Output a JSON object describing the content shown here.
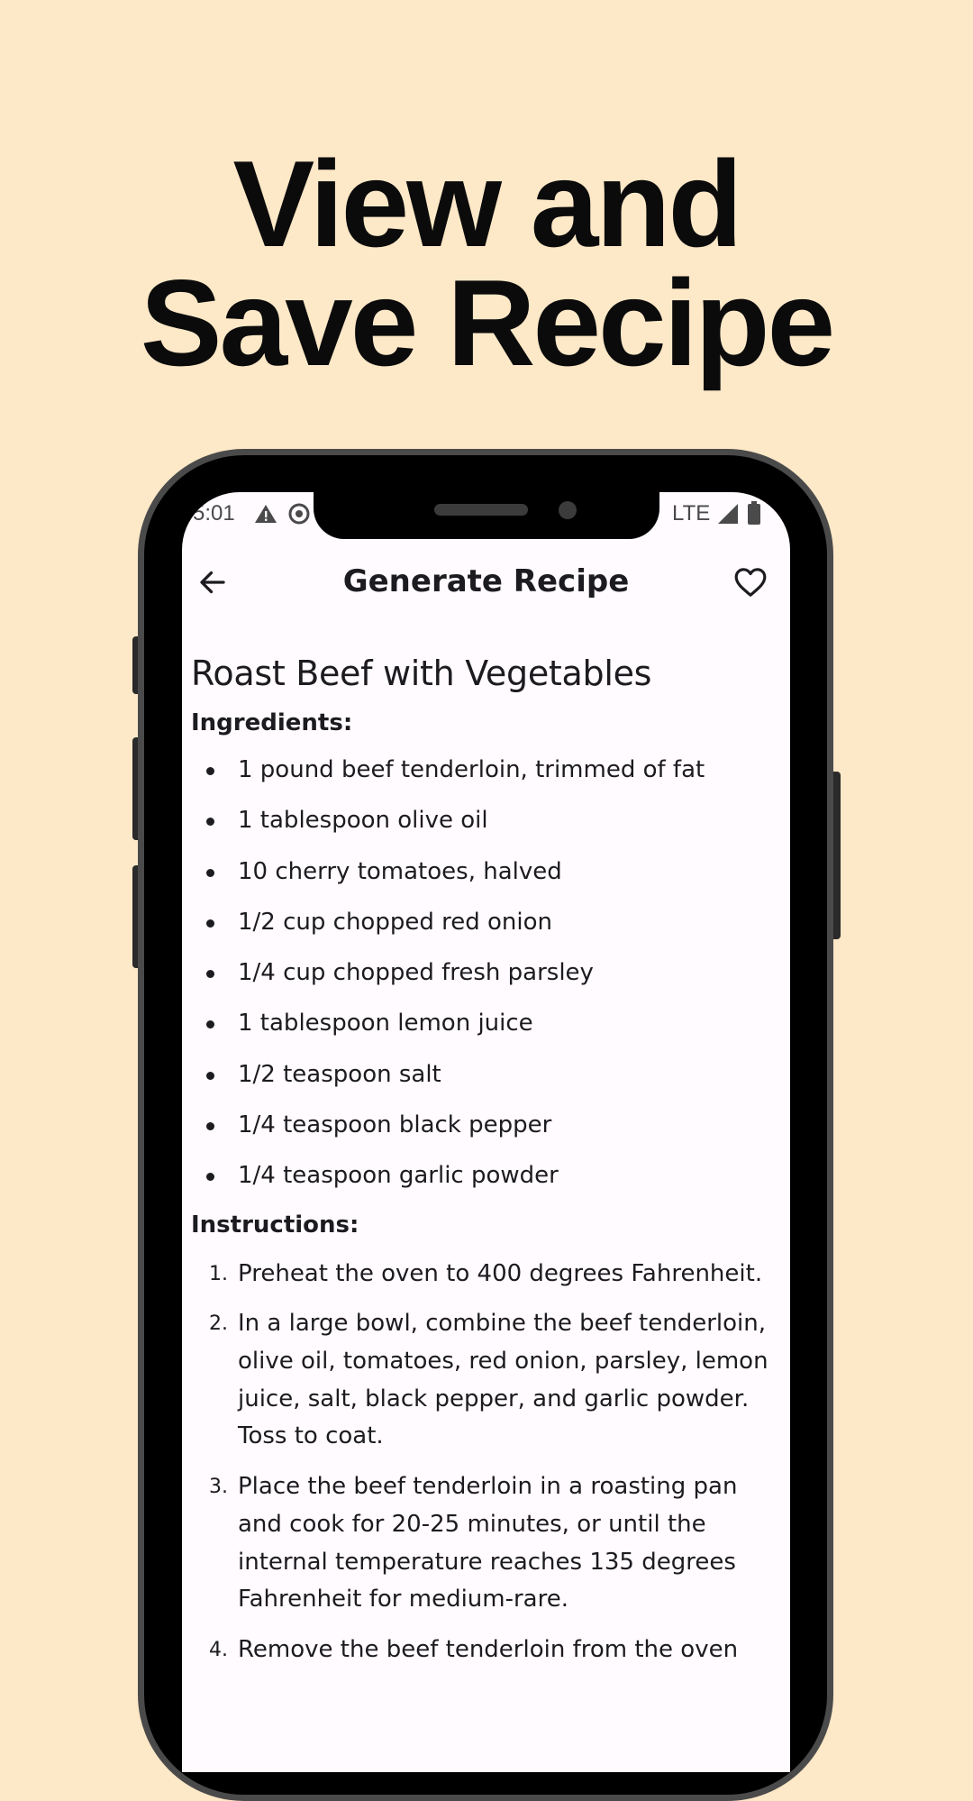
{
  "headline": {
    "line1": "View and",
    "line2": "Save Recipe"
  },
  "status_bar": {
    "time": "5:01",
    "network": "LTE"
  },
  "app_bar": {
    "title": "Generate Recipe",
    "back_icon": "arrow-left-icon",
    "favorite_icon": "heart-outline-icon"
  },
  "recipe": {
    "title": "Roast Beef with Vegetables",
    "ingredients_heading": "Ingredients:",
    "ingredients": [
      "1 pound beef tenderloin, trimmed of fat",
      "1 tablespoon olive oil",
      "10 cherry tomatoes, halved",
      "1/2 cup chopped red onion",
      "1/4 cup chopped fresh parsley",
      "1 tablespoon lemon juice",
      "1/2 teaspoon salt",
      "1/4 teaspoon black pepper",
      "1/4 teaspoon garlic powder"
    ],
    "instructions_heading": "Instructions:",
    "instructions": [
      {
        "num": "1.",
        "text": "Preheat the oven to 400 degrees Fahrenheit."
      },
      {
        "num": "2.",
        "text": "In a large bowl, combine the beef tenderloin, olive oil, tomatoes, red onion, parsley, lemon juice, salt, black pepper, and garlic powder. Toss to coat."
      },
      {
        "num": "3.",
        "text": "Place the beef tenderloin in a roasting pan and cook for 20-25 minutes, or until the internal temperature reaches 135 degrees Fahrenheit for medium-rare."
      },
      {
        "num": "4.",
        "text": "Remove the beef tenderloin from the oven"
      }
    ]
  },
  "colors": {
    "background": "#FDE8C7",
    "screen": "#FFFBFF",
    "text": "#1C1B1F",
    "phone_frame": "#4A4A4A"
  }
}
